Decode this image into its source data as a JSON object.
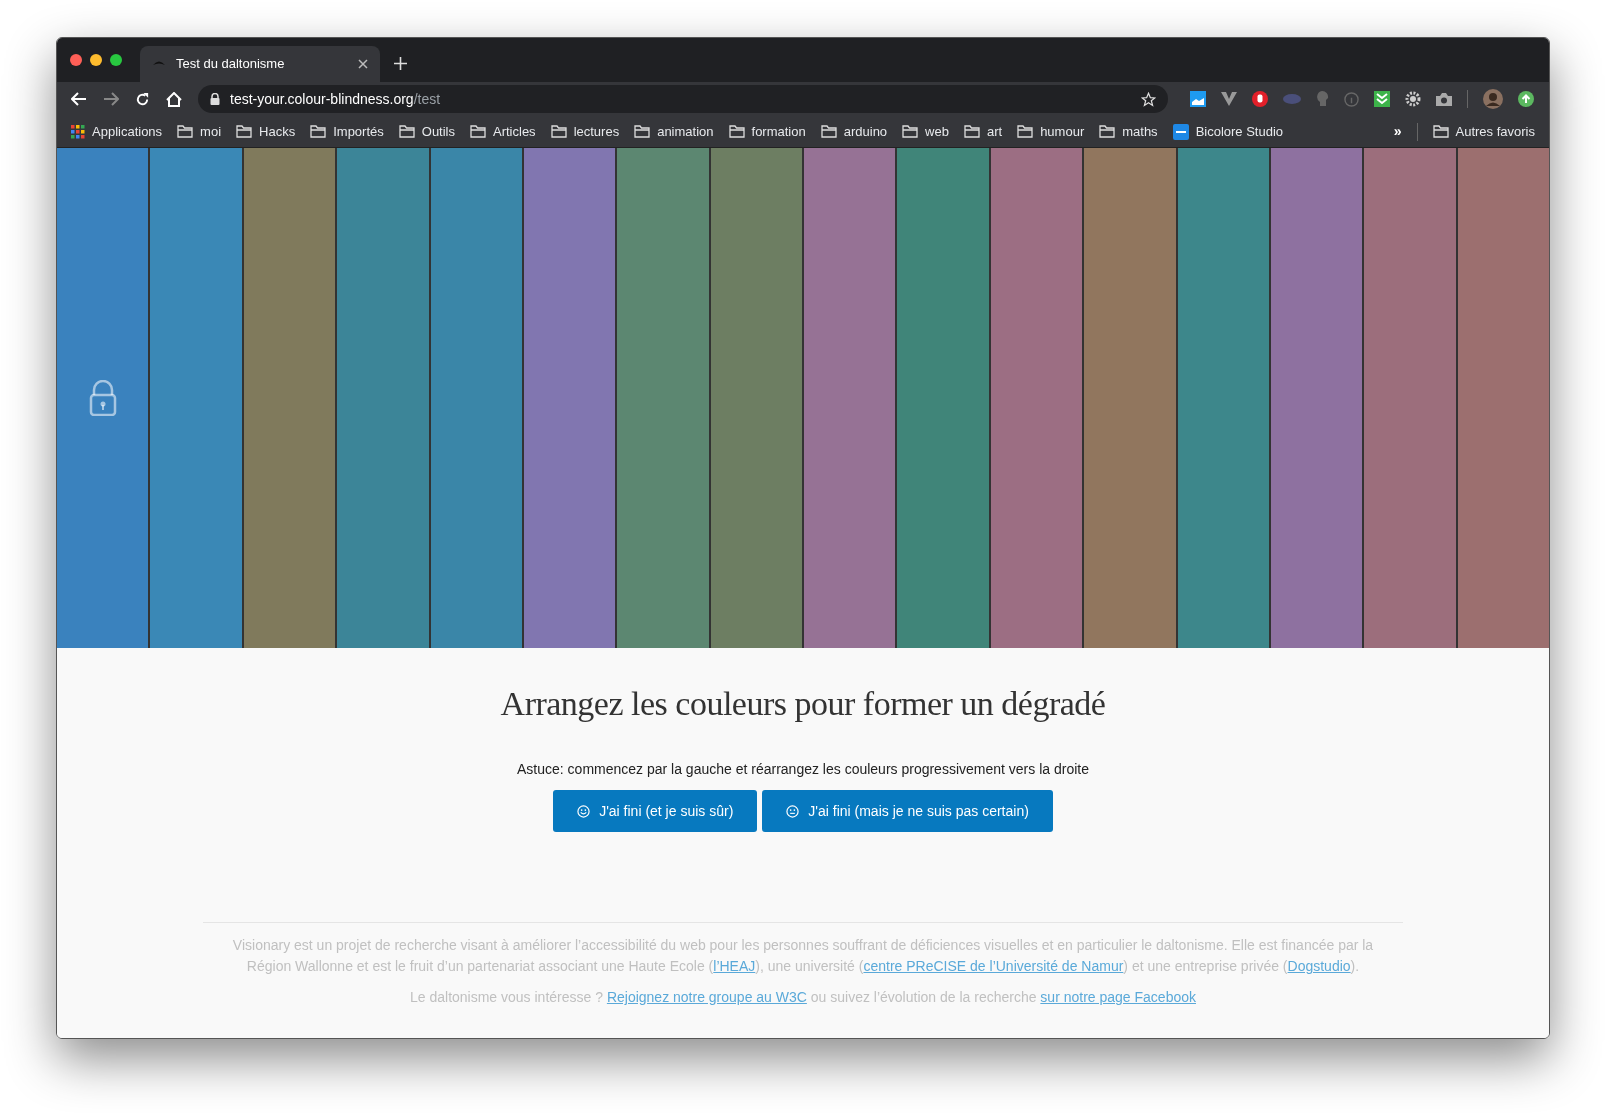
{
  "browser": {
    "tab": {
      "title": "Test du daltonisme"
    },
    "url": {
      "host": "test-your.colour-blindness.org",
      "path": "/test"
    },
    "bookmarks": [
      {
        "label": "Applications",
        "kind": "apps"
      },
      {
        "label": "moi",
        "kind": "folder"
      },
      {
        "label": "Hacks",
        "kind": "folder"
      },
      {
        "label": "Importés",
        "kind": "folder"
      },
      {
        "label": "Outils",
        "kind": "folder"
      },
      {
        "label": "Articles",
        "kind": "folder"
      },
      {
        "label": "lectures",
        "kind": "folder"
      },
      {
        "label": "animation",
        "kind": "folder"
      },
      {
        "label": "formation",
        "kind": "folder"
      },
      {
        "label": "arduino",
        "kind": "folder"
      },
      {
        "label": "web",
        "kind": "folder"
      },
      {
        "label": "art",
        "kind": "folder"
      },
      {
        "label": "humour",
        "kind": "folder"
      },
      {
        "label": "maths",
        "kind": "folder"
      },
      {
        "label": "Bicolore Studio",
        "kind": "site"
      }
    ],
    "overflow": "»",
    "other_bookmarks": "Autres favoris"
  },
  "swatches": [
    {
      "color": "#3a82be",
      "locked": true
    },
    {
      "color": "#3a88b6",
      "locked": false
    },
    {
      "color": "#807a5c",
      "locked": false
    },
    {
      "color": "#3c8598",
      "locked": false
    },
    {
      "color": "#3a86a8",
      "locked": false
    },
    {
      "color": "#8176b0",
      "locked": false
    },
    {
      "color": "#5c8771",
      "locked": false
    },
    {
      "color": "#6d7e62",
      "locked": false
    },
    {
      "color": "#967295",
      "locked": false
    },
    {
      "color": "#408579",
      "locked": false
    },
    {
      "color": "#9c6e83",
      "locked": false
    },
    {
      "color": "#91765e",
      "locked": false
    },
    {
      "color": "#3d878b",
      "locked": false
    },
    {
      "color": "#8e71a0",
      "locked": false
    },
    {
      "color": "#9c6e7c",
      "locked": false
    },
    {
      "color": "#9c6f6f",
      "locked": false
    }
  ],
  "heading": "Arrangez les couleurs pour former un dégradé",
  "hint": "Astuce: commencez par la gauche et réarrangez les couleurs progressivement vers la droite",
  "buttons": [
    {
      "label": "J'ai fini (et je suis sûr)",
      "kind": "smile"
    },
    {
      "label": "J'ai fini (mais je ne suis pas certain)",
      "kind": "neutral"
    }
  ],
  "footer": [
    [
      {
        "kind": "text",
        "text": "Visionary est un projet de recherche visant à améliorer l’accessibilité du web pour les personnes souffrant de déficiences visuelles et en particulier le daltonisme. Elle est financée par la Région Wallonne et est le fruit d’un partenariat associant une Haute Ecole ("
      },
      {
        "kind": "link",
        "text": "l’HEAJ"
      },
      {
        "kind": "text",
        "text": "), une université ("
      },
      {
        "kind": "link",
        "text": "centre PReCISE de l’Université de Namur"
      },
      {
        "kind": "text",
        "text": ") et une entreprise privée ("
      },
      {
        "kind": "link",
        "text": "Dogstudio"
      },
      {
        "kind": "text",
        "text": ")."
      }
    ],
    [
      {
        "kind": "text",
        "text": "Le daltonisme vous intéresse ? "
      },
      {
        "kind": "link",
        "text": "Rejoignez notre groupe au W3C"
      },
      {
        "kind": "text",
        "text": " ou suivez l’évolution de la recherche "
      },
      {
        "kind": "link",
        "text": "sur notre page Facebook"
      }
    ]
  ]
}
